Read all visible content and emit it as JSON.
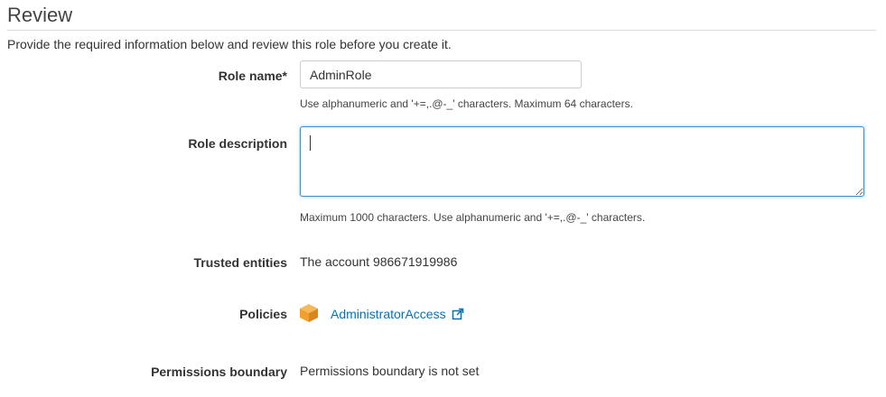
{
  "header": {
    "title": "Review",
    "subtitle": "Provide the required information below and review this role before you create it."
  },
  "form": {
    "role_name": {
      "label": "Role name*",
      "value": "AdminRole",
      "hint": "Use alphanumeric and '+=,.@-_' characters. Maximum 64 characters."
    },
    "role_description": {
      "label": "Role description",
      "value": "",
      "hint": "Maximum 1000 characters. Use alphanumeric and '+=,.@-_' characters."
    },
    "trusted_entities": {
      "label": "Trusted entities",
      "value": "The account 986671919986"
    },
    "policies": {
      "label": "Policies",
      "link_text": "AdministratorAccess",
      "icon": "policy-cube-icon",
      "external_icon": "external-link-icon"
    },
    "permissions_boundary": {
      "label": "Permissions boundary",
      "value": "Permissions boundary is not set"
    }
  },
  "colors": {
    "link": "#0073bb",
    "focus_border": "#3b8fd4",
    "policy_icon": "#f0a030"
  }
}
